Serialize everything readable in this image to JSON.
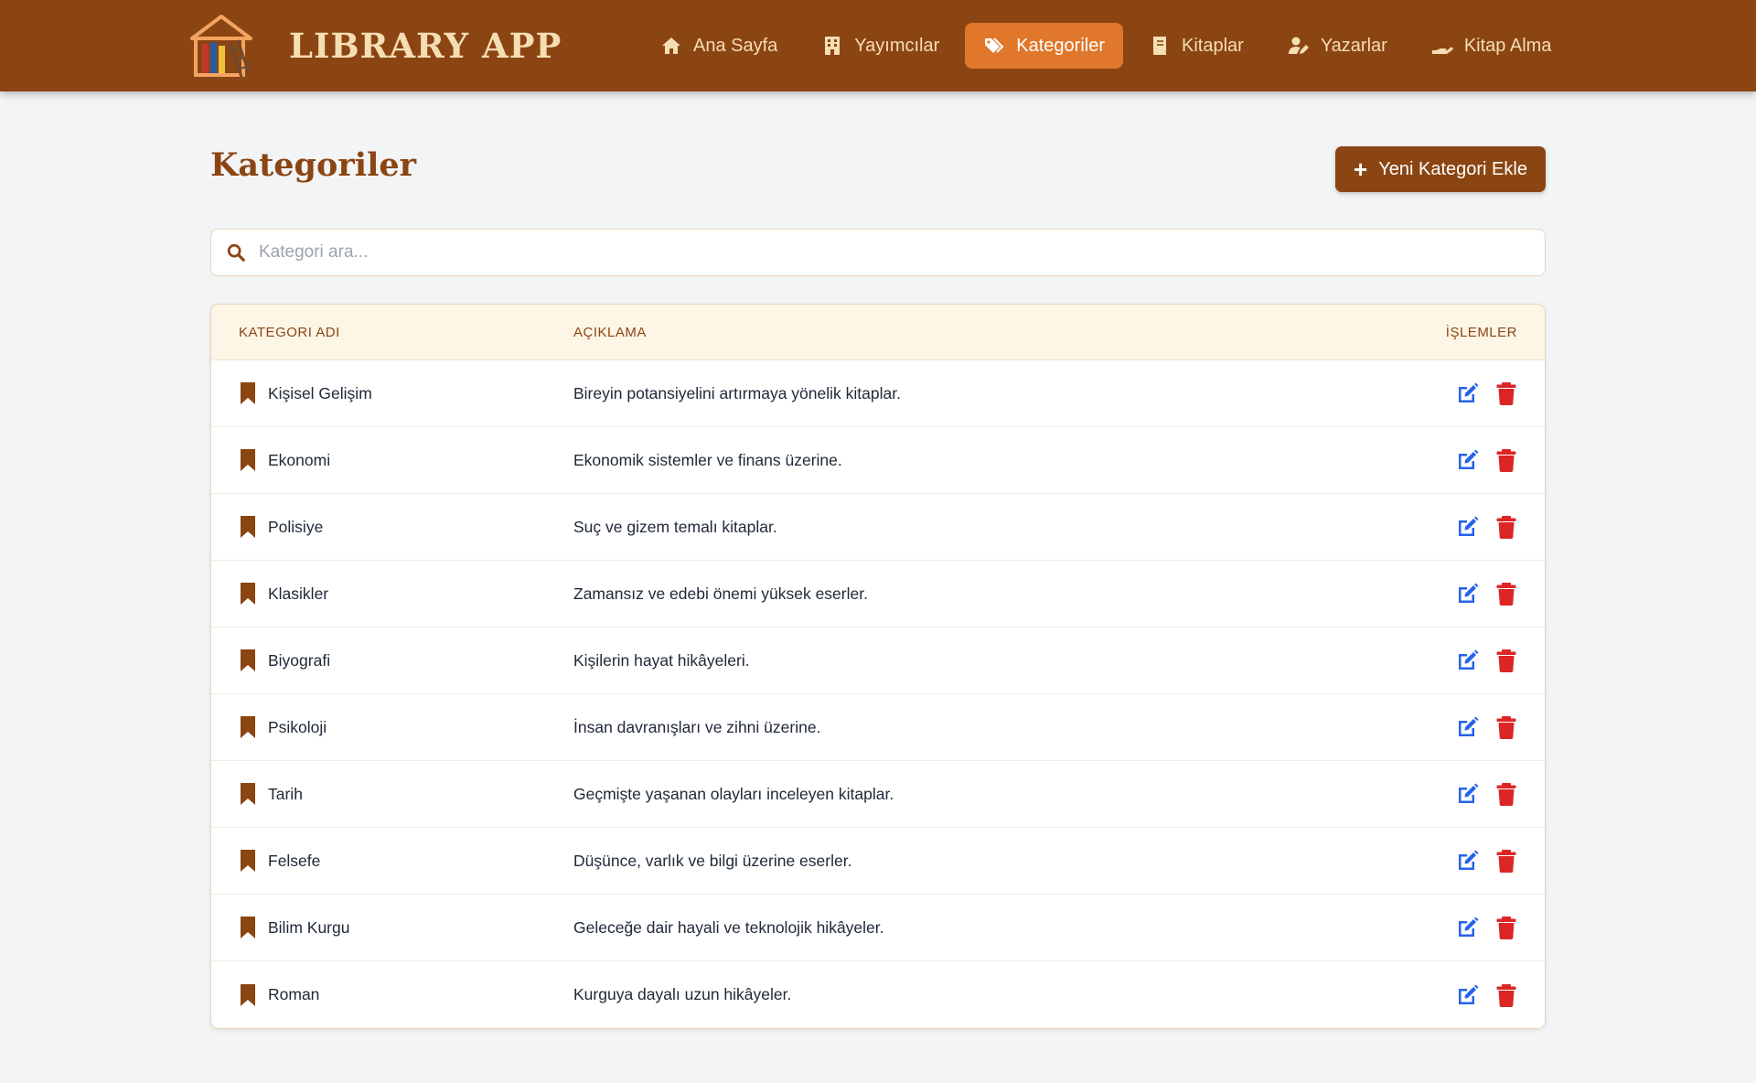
{
  "app": {
    "title": "LIBRARY APP",
    "logo_icon": "library-logo-icon",
    "colors": {
      "primary": "#8b4513",
      "nav_active": "#e0772a",
      "nav_text": "#f5deb3",
      "edit": "#2563eb",
      "delete": "#dc2626",
      "header_bg": "#fdf5e6"
    }
  },
  "nav": {
    "items": [
      {
        "label": "Ana Sayfa",
        "icon": "home-icon",
        "active": false
      },
      {
        "label": "Yayımcılar",
        "icon": "building-icon",
        "active": false
      },
      {
        "label": "Kategoriler",
        "icon": "tags-icon",
        "active": true
      },
      {
        "label": "Kitaplar",
        "icon": "book-icon",
        "active": false
      },
      {
        "label": "Yazarlar",
        "icon": "user-pen-icon",
        "active": false
      },
      {
        "label": "Kitap Alma",
        "icon": "hand-holding-icon",
        "active": false
      }
    ]
  },
  "page": {
    "title": "Kategoriler",
    "add_button_label": "Yeni Kategori Ekle"
  },
  "search": {
    "value": "",
    "placeholder": "Kategori ara..."
  },
  "table": {
    "columns": [
      "KATEGORI ADI",
      "AÇIKLAMA",
      "İŞLEMLER"
    ],
    "rows": [
      {
        "name": "Kişisel Gelişim",
        "description": "Bireyin potansiyelini artırmaya yönelik kitaplar."
      },
      {
        "name": "Ekonomi",
        "description": "Ekonomik sistemler ve finans üzerine."
      },
      {
        "name": "Polisiye",
        "description": "Suç ve gizem temalı kitaplar."
      },
      {
        "name": "Klasikler",
        "description": "Zamansız ve edebi önemi yüksek eserler."
      },
      {
        "name": "Biyografi",
        "description": "Kişilerin hayat hikâyeleri."
      },
      {
        "name": "Psikoloji",
        "description": "İnsan davranışları ve zihni üzerine."
      },
      {
        "name": "Tarih",
        "description": "Geçmişte yaşanan olayları inceleyen kitaplar."
      },
      {
        "name": "Felsefe",
        "description": "Düşünce, varlık ve bilgi üzerine eserler."
      },
      {
        "name": "Bilim Kurgu",
        "description": "Geleceğe dair hayali ve teknolojik hikâyeler."
      },
      {
        "name": "Roman",
        "description": "Kurguya dayalı uzun hikâyeler."
      }
    ]
  }
}
